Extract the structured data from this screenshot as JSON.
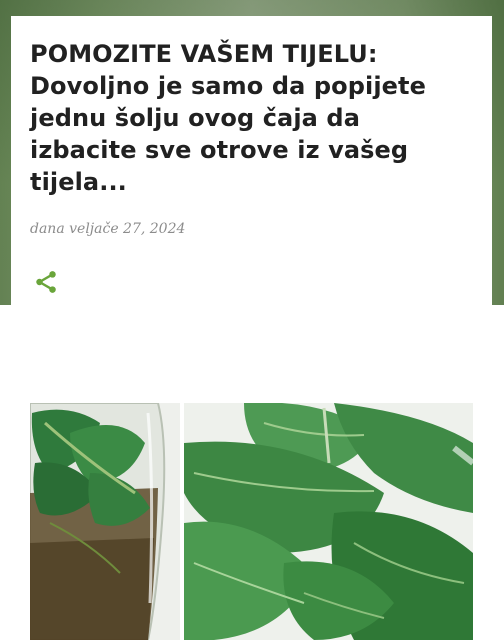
{
  "post": {
    "title": "POMOZITE VAŠEM TIJELU: Dovoljno je samo da popijete jednu šolju ovog čaja da izbacite sve otrove iz vašeg tijela...",
    "date": "dana veljače 27, 2024"
  },
  "icons": {
    "share": "share-icon"
  },
  "colors": {
    "accent_green": "#6aa53b",
    "title_text": "#212121",
    "date_text": "#8c8c8c"
  }
}
